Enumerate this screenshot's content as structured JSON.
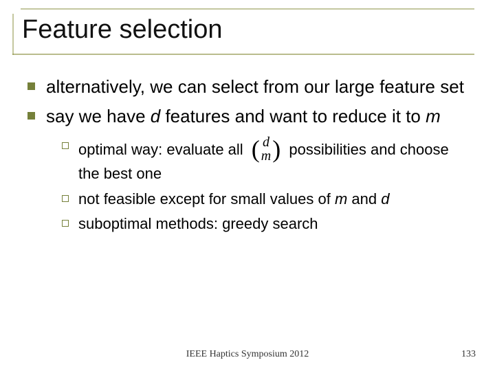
{
  "title": "Feature selection",
  "bullets": [
    {
      "text": "alternatively, we can select from our large feature set"
    },
    {
      "text_parts": [
        "say we have ",
        "d",
        " features and want to reduce it to ",
        "m"
      ]
    }
  ],
  "subbullets": [
    {
      "pre": "optimal way: evaluate all ",
      "binom_top": "d",
      "binom_bot": "m",
      "post": " possibilities and choose the best one"
    },
    {
      "text_parts": [
        "not feasible except for small values of ",
        "m",
        " and ",
        "d"
      ]
    },
    {
      "text": "suboptimal methods: greedy search"
    }
  ],
  "footer": "IEEE Haptics Symposium 2012",
  "page": "133"
}
